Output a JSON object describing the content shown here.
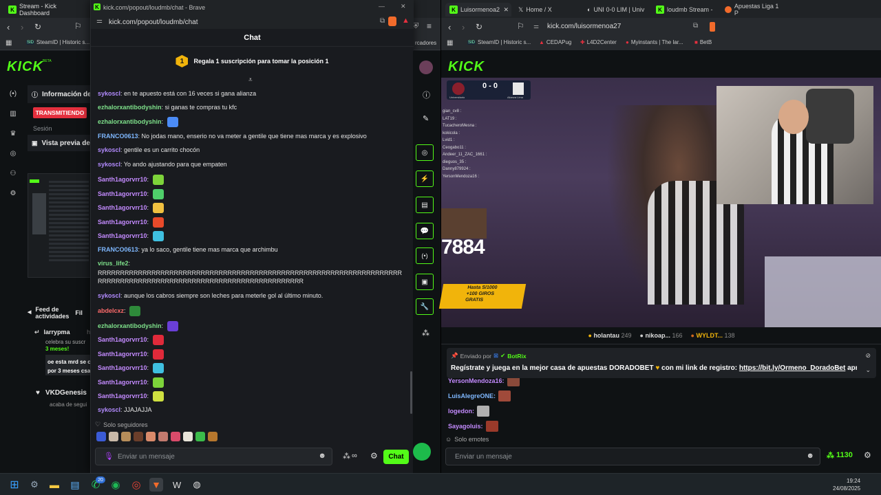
{
  "back_window": {
    "tab_title": "Stream - Kick Dashboard",
    "bookmark_1": "SteamID | Historic s...",
    "bookmark_right": "rcadores",
    "logo": "KICK",
    "info_label": "Información de",
    "status_badge": "TRANSMITIENDO",
    "session_label": "Sesión",
    "preview_label": "Vista previa del",
    "feed_label": "Feed de actividades",
    "feed_filter": "Fil",
    "feed_items": [
      {
        "user": "larrypma",
        "time": "ha",
        "text": "celebra su suscr",
        "months": "3 meses!",
        "comment": "oe esta mrd se c",
        "comment2": "por 3 meses csa"
      },
      {
        "user": "VKDGenesis",
        "text": "acaba de segui"
      }
    ]
  },
  "popup": {
    "title": "kick.com/popout/loudmb/chat - Brave",
    "url": "kick.com/popout/loudmb/chat",
    "header": "Chat",
    "pinned_rank": "1",
    "pinned_text": "Regala 1 suscripción para tomar la posición 1",
    "messages": [
      {
        "user": "sykoscl",
        "color": "#b38bff",
        "text": "en te apuesto está con 16 veces si gana alianza"
      },
      {
        "user": "ezhalorxantibodyshin",
        "color": "#7ee08a",
        "text": "si ganas te compras tu kfc"
      },
      {
        "user": "ezhalorxantibodyshin",
        "color": "#7ee08a",
        "text": ""
      },
      {
        "user": "FRANCO0613",
        "color": "#7fb8ff",
        "text": "No jodas mano, enserio no va meter a gentile que tiene mas marca y es explosivo"
      },
      {
        "user": "sykoscl",
        "color": "#b38bff",
        "text": "gentile es un carrito chocón"
      },
      {
        "user": "sykoscl",
        "color": "#b38bff",
        "text": "Yo ando ajustando para que empaten"
      },
      {
        "user": "Santh1agorvrr10",
        "color": "#c48bff",
        "text": ""
      },
      {
        "user": "Santh1agorvrr10",
        "color": "#c48bff",
        "text": ""
      },
      {
        "user": "Santh1agorvrr10",
        "color": "#c48bff",
        "text": ""
      },
      {
        "user": "Santh1agorvrr10",
        "color": "#c48bff",
        "text": ""
      },
      {
        "user": "Santh1agorvrr10",
        "color": "#c48bff",
        "text": ""
      },
      {
        "user": "FRANCO0613",
        "color": "#7fb8ff",
        "text": "ya lo saco, gentile tiene mas marca que archimbu"
      },
      {
        "user": "virus_life2",
        "color": "#7ee08a",
        "text": "RRRRRRRRRRRRRRRRRRRRRRRRRRRRRRRRRRRRRRRRRRRRRRRRRRRRRRRRRRRRRRRRRRRRRRRRRRRRRRRRRRRRRRRRRRRRRRRRRRRRRRRRRRRRRRRRRR"
      },
      {
        "user": "sykoscl",
        "color": "#b38bff",
        "text": "aunque los cabros siempre son leches para meterle gol al último minuto."
      },
      {
        "user": "abdelcxz",
        "color": "#ff6b6b",
        "text": ""
      },
      {
        "user": "ezhalorxantibodyshin",
        "color": "#7ee08a",
        "text": ""
      },
      {
        "user": "Santh1agorvrr10",
        "color": "#c48bff",
        "text": ""
      },
      {
        "user": "Santh1agorvrr10",
        "color": "#c48bff",
        "text": ""
      },
      {
        "user": "Santh1agorvrr10",
        "color": "#c48bff",
        "text": ""
      },
      {
        "user": "Santh1agorvrr10",
        "color": "#c48bff",
        "text": ""
      },
      {
        "user": "Santh1agorvrr10",
        "color": "#c48bff",
        "text": ""
      },
      {
        "user": "sykoscl",
        "color": "#b38bff",
        "text": "JJAJAJJA"
      }
    ],
    "mode_label": "Solo seguidores",
    "input_placeholder": "Enviar un mensaje",
    "chat_button": "Chat"
  },
  "right_window": {
    "tabs": [
      "Luisormenoa2",
      "Home / X",
      "UNI 0-0 LIM | Univ",
      "loudmb Stream - ",
      "Apuestas Liga 1 P"
    ],
    "url": "kick.com/luisormenoa27",
    "bookmarks": [
      "SteamID | Historic s...",
      "CEDAPug",
      "L4D2Center",
      "Myinstants | The lar...",
      "BetB"
    ],
    "logo": "KICK",
    "score": "0 - 0",
    "team_home": "Universitario",
    "team_away": "Alianza Lima",
    "overlay_number": "7884",
    "overlay_promo_1": "Hasta S/1000",
    "overlay_promo_2": "+100 GIROS",
    "overlay_promo_3": "GRATIS",
    "overlay_chat": [
      "gian_cv8 :",
      "LAT19 :",
      "TucacheroMesna :",
      "kokicola :",
      "Lvid1 :",
      "Ceogabo11 :",
      "Andeer_11_ZAC_1661 :",
      "dieguos_35 :",
      "Danny879924 :",
      "YersonMendoza16 :"
    ],
    "gifters": [
      {
        "name": "holantau",
        "count": "249"
      },
      {
        "name": "nikoap...",
        "count": "166"
      },
      {
        "name": "WYLDT...",
        "count": "138"
      }
    ],
    "bot_sent_by": "Enviado por",
    "bot_name": "BotRix",
    "bot_message": "Regístrate y juega en la mejor casa de apuestas DORADOBET",
    "bot_message_2": "con mi link de registro:",
    "bot_link": "https://bit.ly/Ormeno_DoradoBet",
    "bot_message_3": "aprovec...",
    "chat": [
      {
        "user": "YersonMendoza16:",
        "color": "#c48bff"
      },
      {
        "user": "LuisAlegreONE:",
        "color": "#7fb8ff"
      },
      {
        "user": "logedon:",
        "color": "#c48bff"
      },
      {
        "user": "Sayagoluis:",
        "color": "#c48bff"
      }
    ],
    "mode_label": "Solo emotes",
    "input_placeholder": "Enviar un mensaje",
    "points": "1130"
  },
  "taskbar": {
    "time": "19:24",
    "date": "24/08/2025",
    "whatsapp_badge": "20"
  },
  "colors": {
    "kick_green": "#53fc18",
    "pinned_gold": "#f1b40b",
    "live_red": "#e5303e"
  }
}
